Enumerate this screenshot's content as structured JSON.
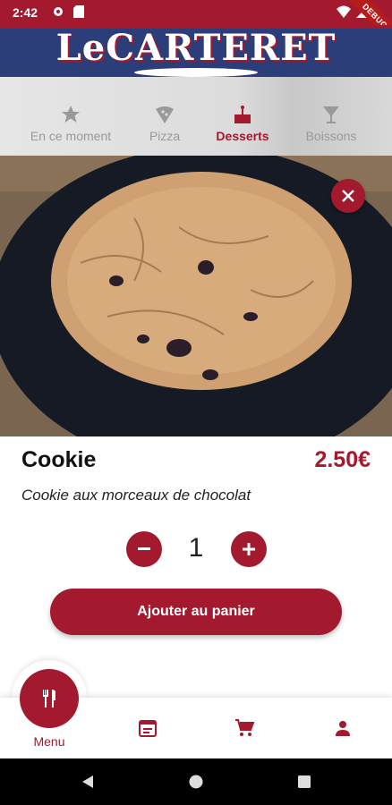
{
  "status_bar": {
    "time": "2:42",
    "debug_label": "DEBUG"
  },
  "header": {
    "logo_text": "LeCARTERET"
  },
  "tabs": [
    {
      "label": "En ce moment",
      "icon": "star-icon",
      "active": false
    },
    {
      "label": "Pizza",
      "icon": "pizza-icon",
      "active": false
    },
    {
      "label": "Desserts",
      "icon": "cake-icon",
      "active": true
    },
    {
      "label": "Boissons",
      "icon": "cocktail-icon",
      "active": false
    }
  ],
  "product": {
    "name": "Cookie",
    "price": "2.50€",
    "description": "Cookie aux morceaux de chocolat",
    "quantity": "1",
    "add_to_cart_label": "Ajouter au panier",
    "image": "cookie-photo"
  },
  "bottom_nav": {
    "active_label": "Menu",
    "items": [
      "menu-icon",
      "calendar-icon",
      "cart-icon",
      "person-icon"
    ]
  },
  "colors": {
    "primary": "#a3192e",
    "header_blue": "#2c3e7a",
    "inactive_tab": "#999999"
  }
}
